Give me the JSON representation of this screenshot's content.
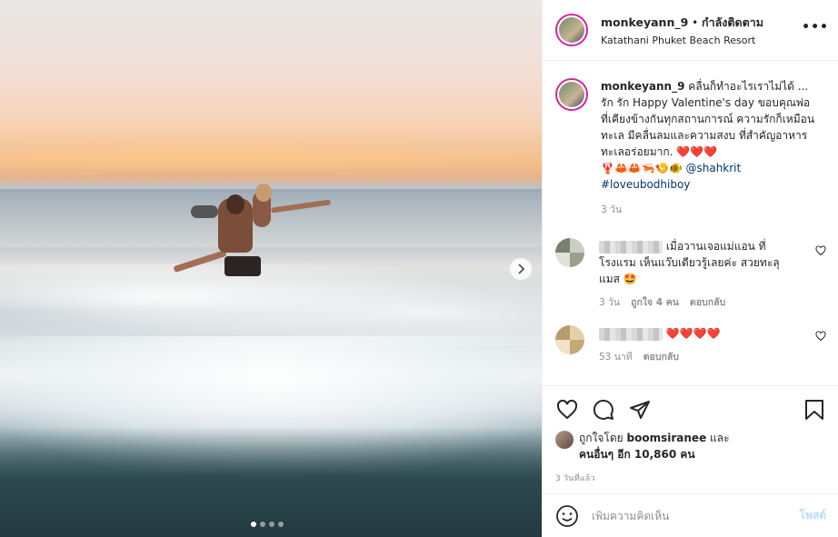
{
  "header": {
    "username": "monkeyann_9",
    "separator": "•",
    "follow_label": "กำลังติดตาม",
    "location": "Katathani Phuket Beach Resort",
    "more_label": "•••"
  },
  "caption": {
    "username": "monkeyann_9",
    "text": "คลื่นก็ทำอะไรเราไม่ได้ ... รัก รัก Happy Valentine's day ขอบคุณพ่อที่เคียงข้างกันทุกสถานการณ์ ความรักก็เหมือนทะเล มีคลื่นลมและความสงบ ที่สำคัญอาหารทะเลอร่อยมาก.",
    "hearts": "❤️❤️❤️",
    "emojis": "🦞🦀🦀🦐🍤🐠",
    "mention": "@shahkrit",
    "hashtag": "#loveubodhiboy",
    "time": "3 วัน"
  },
  "comments": [
    {
      "text": "เมื่อวานเจอแม่แอน ที่โรงแรม เห็นแว๊บเดียวรู้เลยค่ะ สวยทะลุแมส 🤩",
      "time": "3 วัน",
      "likes": "ถูกใจ 4 คน",
      "reply": "ตอบกลับ"
    },
    {
      "text": "❤️❤️❤️❤️",
      "time": "53 นาที",
      "reply": "ตอบกลับ"
    }
  ],
  "likes": {
    "prefix": "ถูกใจโดย",
    "liker": "boomsiranee",
    "and": "และ",
    "others": "คนอื่นๆ อีก 10,860 คน"
  },
  "posted_ago": "3 วันที่แล้ว",
  "add_comment": {
    "placeholder": "เพิ่มความคิดเห็น",
    "post_label": "โพสต์"
  },
  "carousel": {
    "slide_count": 4,
    "active_index": 0
  },
  "icons": {
    "like": "heart-icon",
    "comment": "comment-icon",
    "share": "paper-plane-icon",
    "save": "bookmark-icon",
    "emoji": "smiley-icon",
    "next": "chevron-right-icon"
  },
  "colors": {
    "text": "#262626",
    "muted": "#8e8e8e",
    "link": "#00376b",
    "heart": "#e0245e",
    "post_button": "#b2dffc"
  }
}
